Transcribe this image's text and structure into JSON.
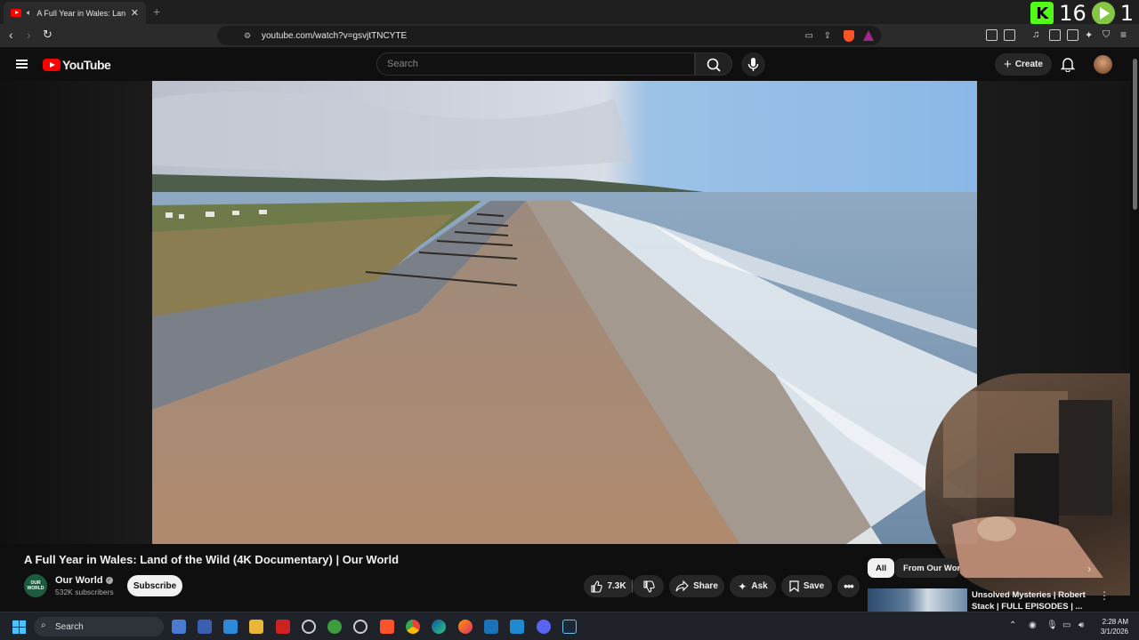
{
  "browser": {
    "tab_title": "A Full Year in Wales: Land of the Wild",
    "url": "youtube.com/watch?v=gsvjtTNCYTE",
    "overlay_counters": [
      "16",
      "1"
    ]
  },
  "youtube": {
    "logo_text": "YouTube",
    "search_placeholder": "Search",
    "create_label": "Create"
  },
  "video": {
    "title": "A Full Year in Wales: Land of the Wild (4K Documentary) | Our World",
    "channel_name": "Our World",
    "channel_logo_text": "OUR WORLD",
    "subscribers": "532K subscribers",
    "subscribe_label": "Subscribe",
    "likes": "7.3K",
    "share_label": "Share",
    "ask_label": "Ask",
    "save_label": "Save"
  },
  "sidebar": {
    "chips": [
      "All",
      "From Our World"
    ],
    "related": [
      {
        "title": "Unsolved Mysteries | Robert Stack | FULL EPISODES | ..."
      }
    ]
  },
  "taskbar": {
    "search_placeholder": "Search",
    "time": "2:28 AM",
    "date": "3/1/2026"
  }
}
